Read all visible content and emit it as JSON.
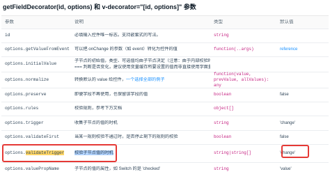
{
  "title": "getFieldDecorator(id, options) 和 v-decorator=\"[id, options]\" 参数",
  "columns": [
    "参数",
    "说明",
    "类型",
    "默认值"
  ],
  "rows": [
    {
      "param": "id",
      "desc": [
        "必填输入控件唯一标志。支持嵌套式的写法。"
      ],
      "type": "string",
      "default": ""
    },
    {
      "param": "options.getValueFromEvent",
      "desc": [
        "可以把 onChange 的参数（如 event）转化为控件的值"
      ],
      "type": "function(..args)",
      "default": "reference"
    },
    {
      "param": "options.initialValue",
      "desc": [
        "子节点的初始值，类型、可选值均由子节点决定（注意：由于内部校验时使用",
        "=== 判断是否变化，建议使用变量缓存所要设置的值而非直接使用字面量）"
      ],
      "type": "",
      "default": ""
    },
    {
      "param": "options.normalize",
      "desc": [
        "转换默认的 value 给控件，"
      ],
      "link": "一个选择全部的例子",
      "type": "function(value, prevValue, allValues): any",
      "default": ""
    },
    {
      "param": "options.preserve",
      "desc": [
        "即便字段不再使用，也保留该字段的值"
      ],
      "type": "boolean",
      "default": "false"
    },
    {
      "param": "options.rules",
      "desc": [
        "校验规则，参考下方文档"
      ],
      "type": "object[]",
      "default": ""
    },
    {
      "param": "options.trigger",
      "desc": [
        "收集子节点的值的时机"
      ],
      "type": "string",
      "default": "'change'"
    },
    {
      "param": "options.validateFirst",
      "desc": [
        "当某一规则校验不通过时，是否停止剩下的规则的校验"
      ],
      "type": "boolean",
      "default": "false"
    },
    {
      "param_prefix": "options.",
      "param_highlight": "validateTrigger",
      "desc_highlight": "校验子节点值的时机",
      "type": "string|string[]",
      "default": "'change'"
    },
    {
      "param": "options.valuePropName",
      "desc": [
        "子节点的值的属性，如 Switch 的是 'checked'"
      ],
      "type": "string",
      "default": "'value'"
    }
  ],
  "colors": {
    "type": "#c41d7f",
    "link": "#1890ff",
    "highlight_yellow": "#ffd666",
    "highlight_blue": "#b3d4ff",
    "annotation_red": "#e53935"
  }
}
